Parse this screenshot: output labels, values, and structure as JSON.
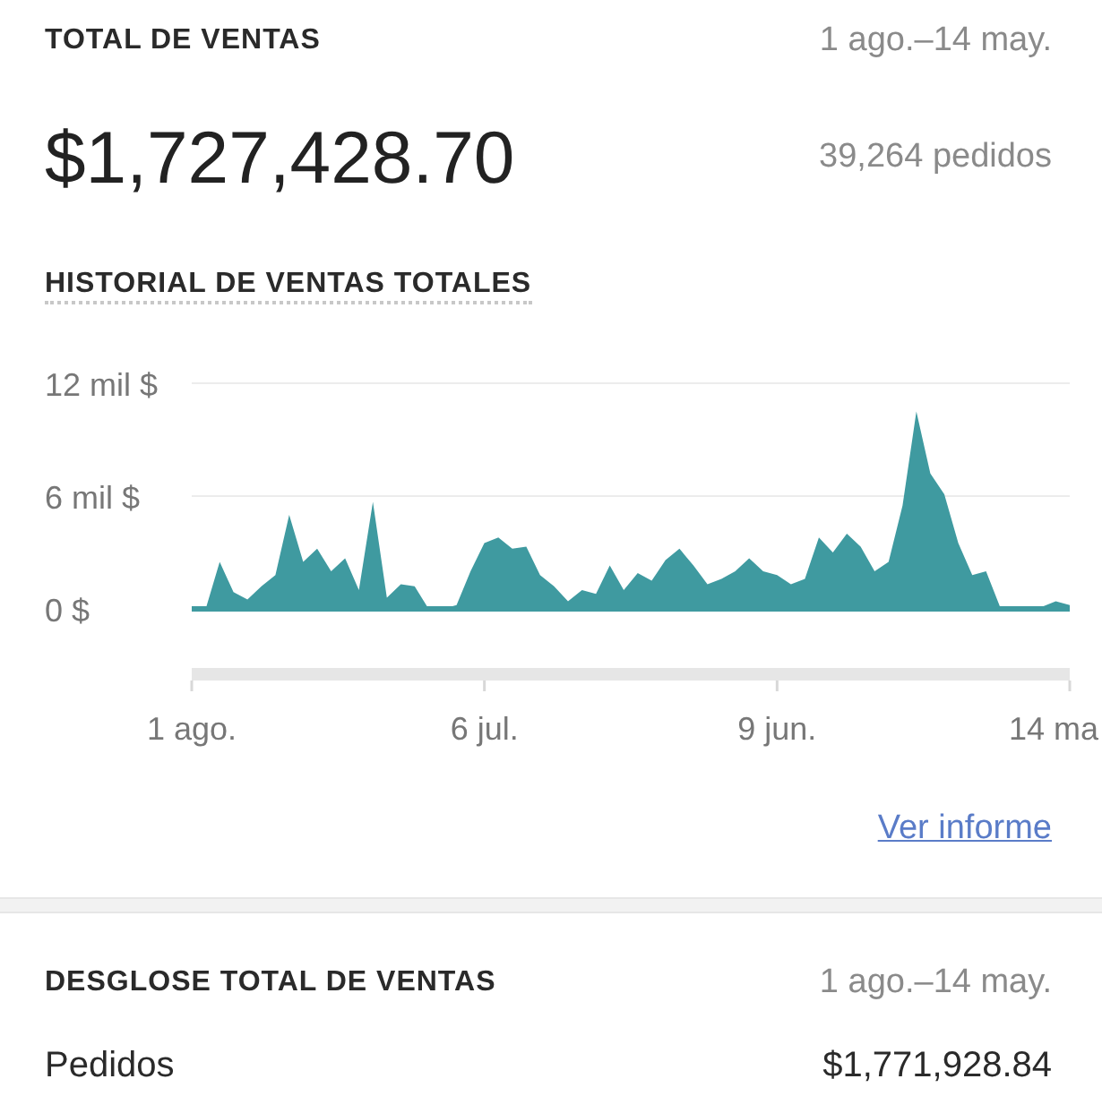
{
  "summary": {
    "title": "TOTAL DE VENTAS",
    "date_range": "1 ago.–14 may.",
    "amount": "$1,727,428.70",
    "orders": "39,264 pedidos"
  },
  "history": {
    "title": "HISTORIAL DE VENTAS TOTALES",
    "chart_data": {
      "type": "area",
      "categories": [
        "1 ago.",
        null,
        null,
        null,
        null,
        null,
        null,
        null,
        null,
        null,
        null,
        null,
        null,
        null,
        null,
        null,
        null,
        null,
        null,
        null,
        null,
        "6 jul.",
        null,
        null,
        null,
        null,
        null,
        null,
        null,
        null,
        null,
        null,
        null,
        null,
        null,
        null,
        null,
        null,
        null,
        null,
        null,
        null,
        "9 jun.",
        null,
        null,
        null,
        null,
        null,
        null,
        null,
        null,
        null,
        null,
        null,
        null,
        null,
        null,
        null,
        null,
        null,
        null,
        null,
        null,
        "14 ma"
      ],
      "series": [
        {
          "color": "#3f9aa0",
          "values": [
            0,
            0,
            2.5,
            0.9,
            0.5,
            1.2,
            1.8,
            5,
            2.5,
            3.2,
            2,
            2.7,
            1,
            5.7,
            0.6,
            1.3,
            1.2,
            0,
            0,
            0.2,
            2,
            3.5,
            3.8,
            3.2,
            3.3,
            1.8,
            1.2,
            0.4,
            1,
            0.8,
            2.3,
            1,
            1.9,
            1.5,
            2.6,
            3.2,
            2.3,
            1.3,
            1.6,
            2,
            2.7,
            2,
            1.8,
            1.3,
            1.6,
            3.8,
            3,
            4,
            3.3,
            2,
            2.5,
            5.5,
            10.5,
            7.2,
            6.1,
            3.5,
            1.8,
            2,
            0.1,
            0.1,
            0.1,
            0.1,
            0.4,
            0.2
          ]
        }
      ],
      "ylim": [
        0,
        12
      ],
      "yticks": [
        {
          "value": 0,
          "label": "0 $"
        },
        {
          "value": 6,
          "label": "6 mil $"
        },
        {
          "value": 12,
          "label": "12 mil $"
        }
      ]
    },
    "link": "Ver informe"
  },
  "breakdown": {
    "title": "DESGLOSE TOTAL DE VENTAS",
    "date_range": "1 ago.–14 may.",
    "rows": [
      {
        "label": "Pedidos",
        "value": "$1,771,928.84"
      }
    ]
  }
}
